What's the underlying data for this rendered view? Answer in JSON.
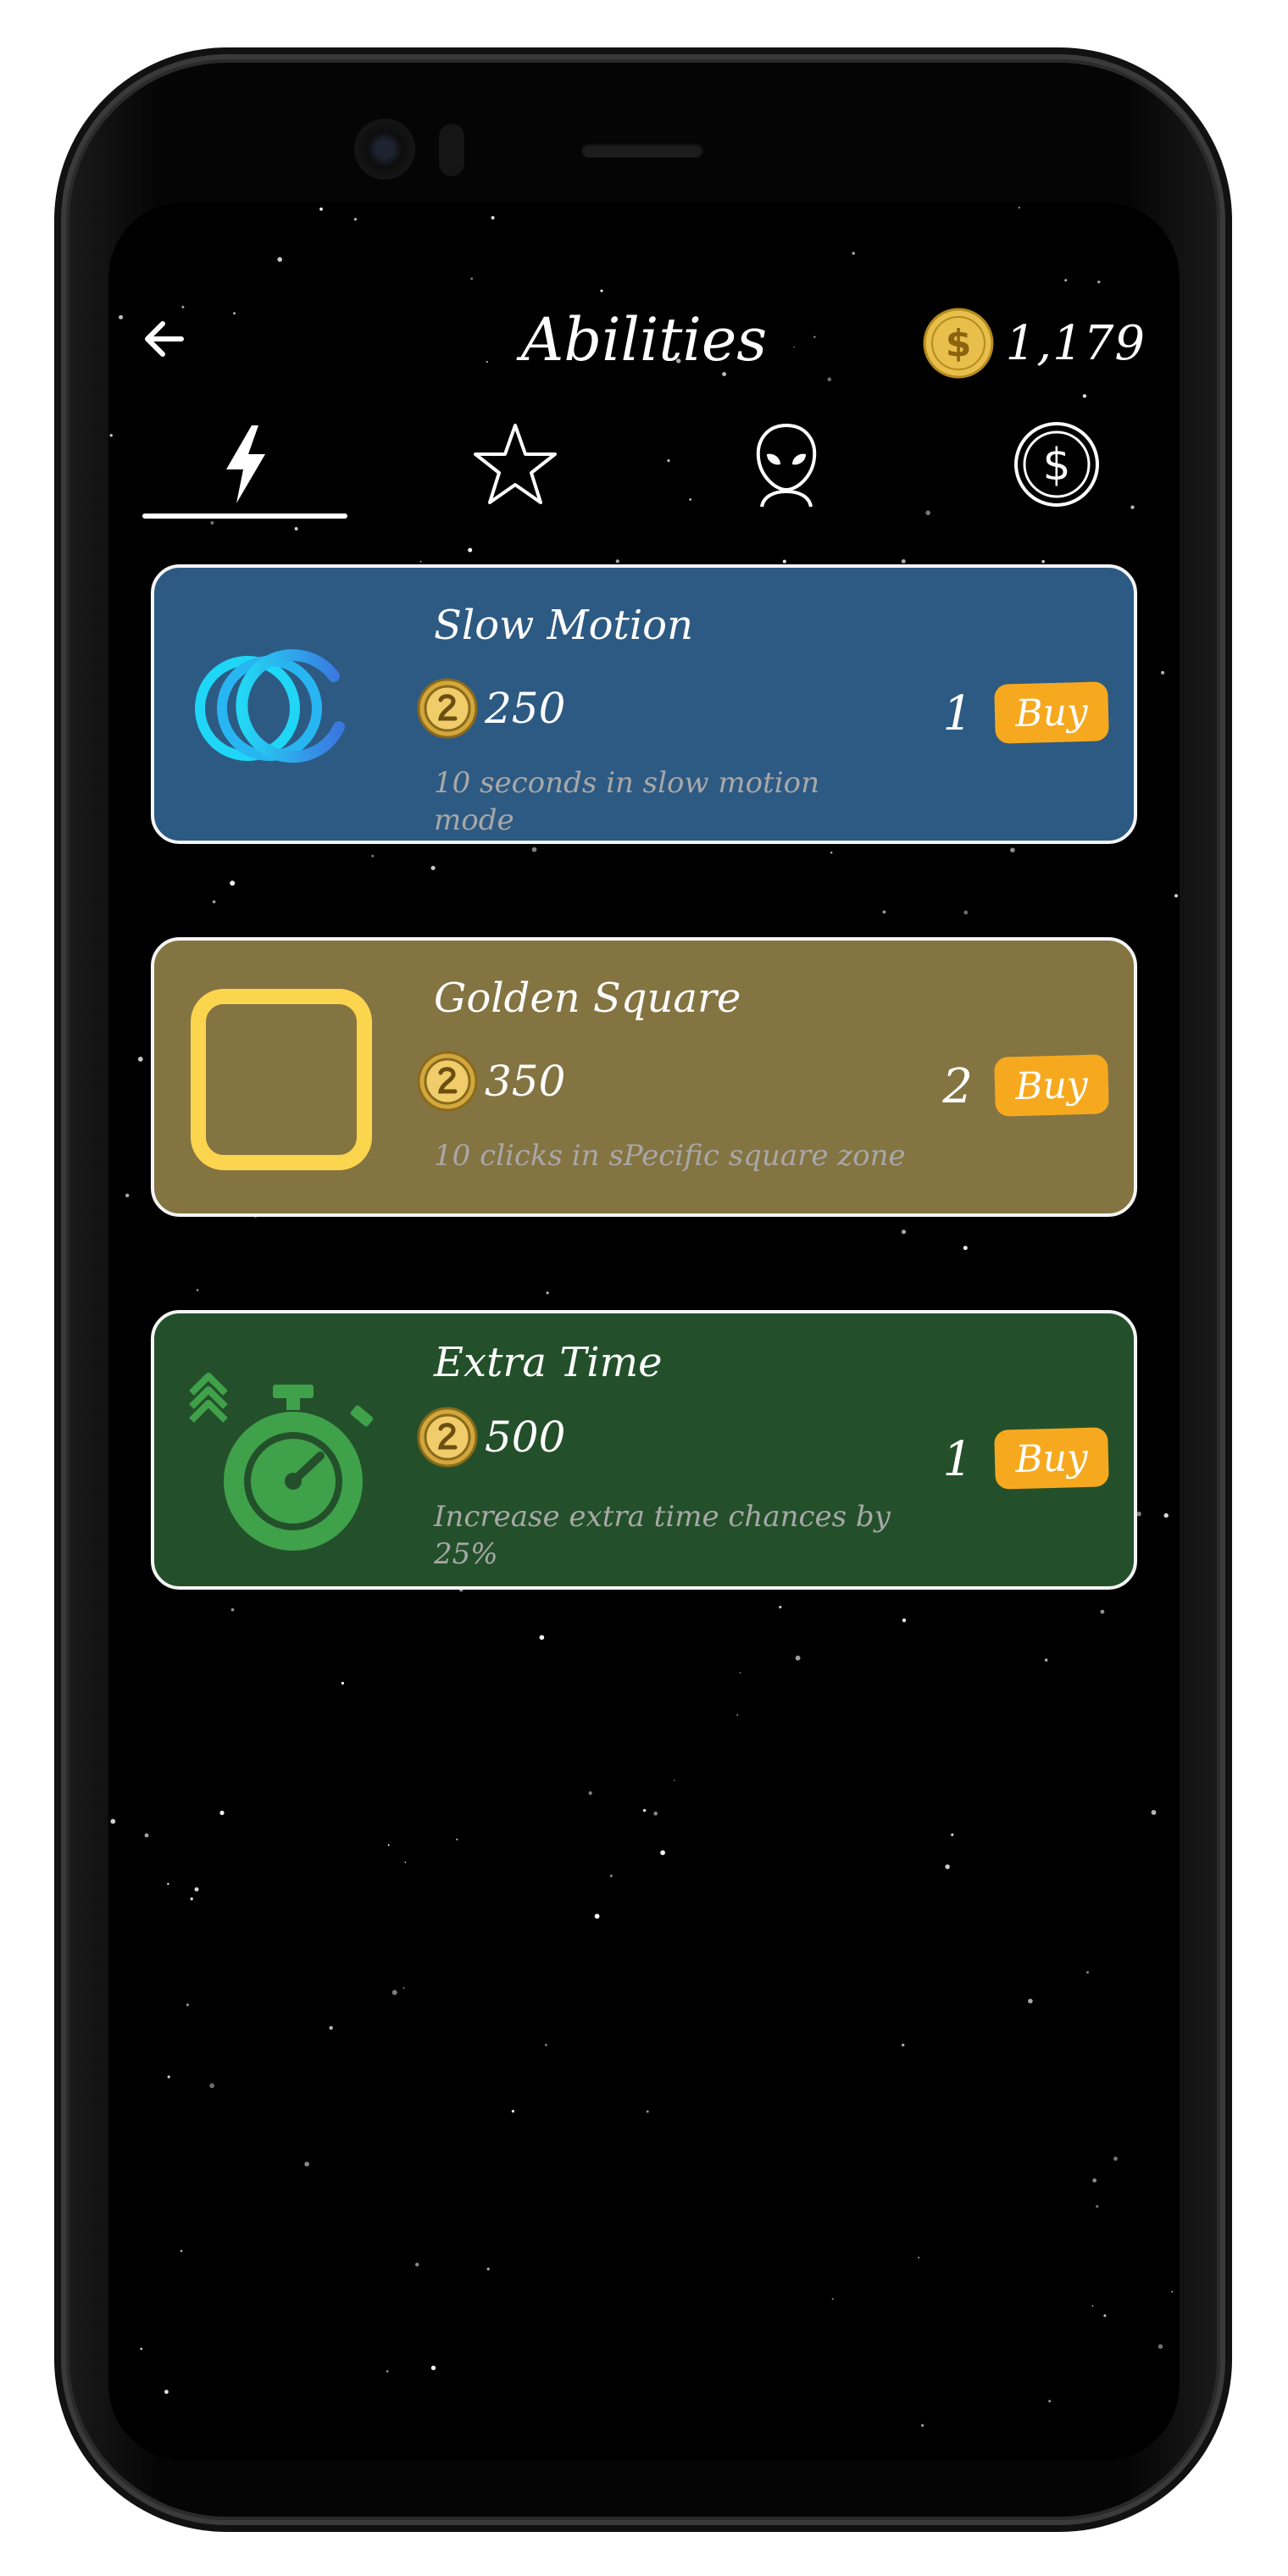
{
  "header": {
    "title": "Abilities",
    "coins": "1,179"
  },
  "tabs": [
    {
      "icon": "lightning-icon",
      "active": true
    },
    {
      "icon": "star-icon",
      "active": false
    },
    {
      "icon": "alien-icon",
      "active": false
    },
    {
      "icon": "dollar-coin-icon",
      "active": false
    }
  ],
  "abilities": [
    {
      "name": "Slow Motion",
      "price": "250",
      "description": "10 seconds in slow motion mode",
      "owned": "1",
      "buy_label": "Buy",
      "icon": "slow-motion-rings-icon",
      "color": "#2d5a83"
    },
    {
      "name": "Golden Square",
      "price": "350",
      "description": "10 clicks in sPecific square zone",
      "owned": "2",
      "buy_label": "Buy",
      "icon": "golden-square-icon",
      "color": "#847442"
    },
    {
      "name": "Extra Time",
      "price": "500",
      "description": "Increase extra time chances by 25%",
      "owned": "1",
      "buy_label": "Buy",
      "icon": "stopwatch-icon",
      "color": "#23502a"
    }
  ],
  "colors": {
    "accent": "#f6a91e",
    "coin": "#e8bf4a",
    "background": "#000000"
  }
}
